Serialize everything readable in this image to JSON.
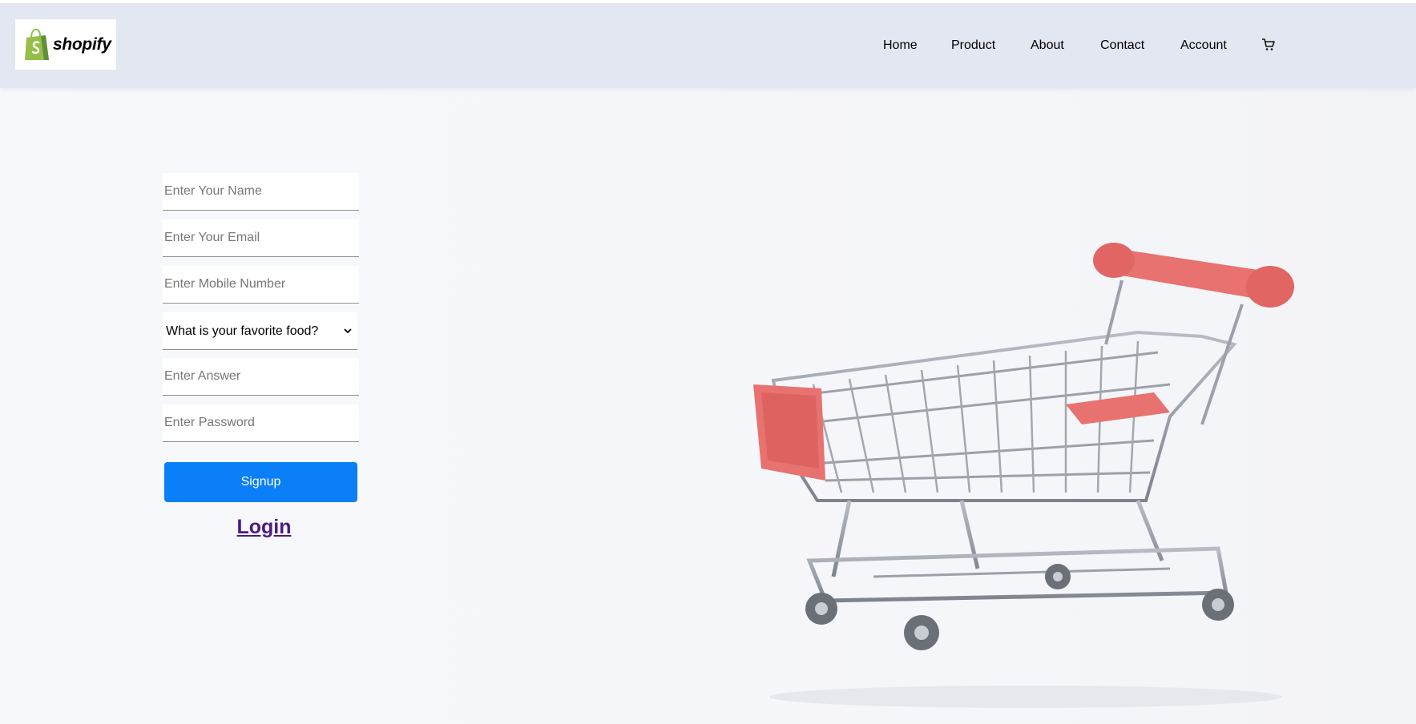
{
  "brand": {
    "name": "shopify",
    "accent_color": "#95bf47"
  },
  "nav": {
    "items": [
      {
        "label": "Home"
      },
      {
        "label": "Product"
      },
      {
        "label": "About"
      },
      {
        "label": "Contact"
      },
      {
        "label": "Account"
      }
    ],
    "cart_icon": "shopping-cart-icon"
  },
  "form": {
    "name_placeholder": "Enter Your Name",
    "email_placeholder": "Enter Your Email",
    "mobile_placeholder": "Enter Mobile Number",
    "security_question_selected": "What is your favorite food?",
    "answer_placeholder": "Enter Answer",
    "password_placeholder": "Enter Password",
    "signup_label": "Signup",
    "login_label": "Login"
  },
  "colors": {
    "navbar_bg": "#e3e7f1",
    "button_bg": "#0a7ff8",
    "link_color": "#4b1a86",
    "cart_accent": "#e8726f"
  }
}
